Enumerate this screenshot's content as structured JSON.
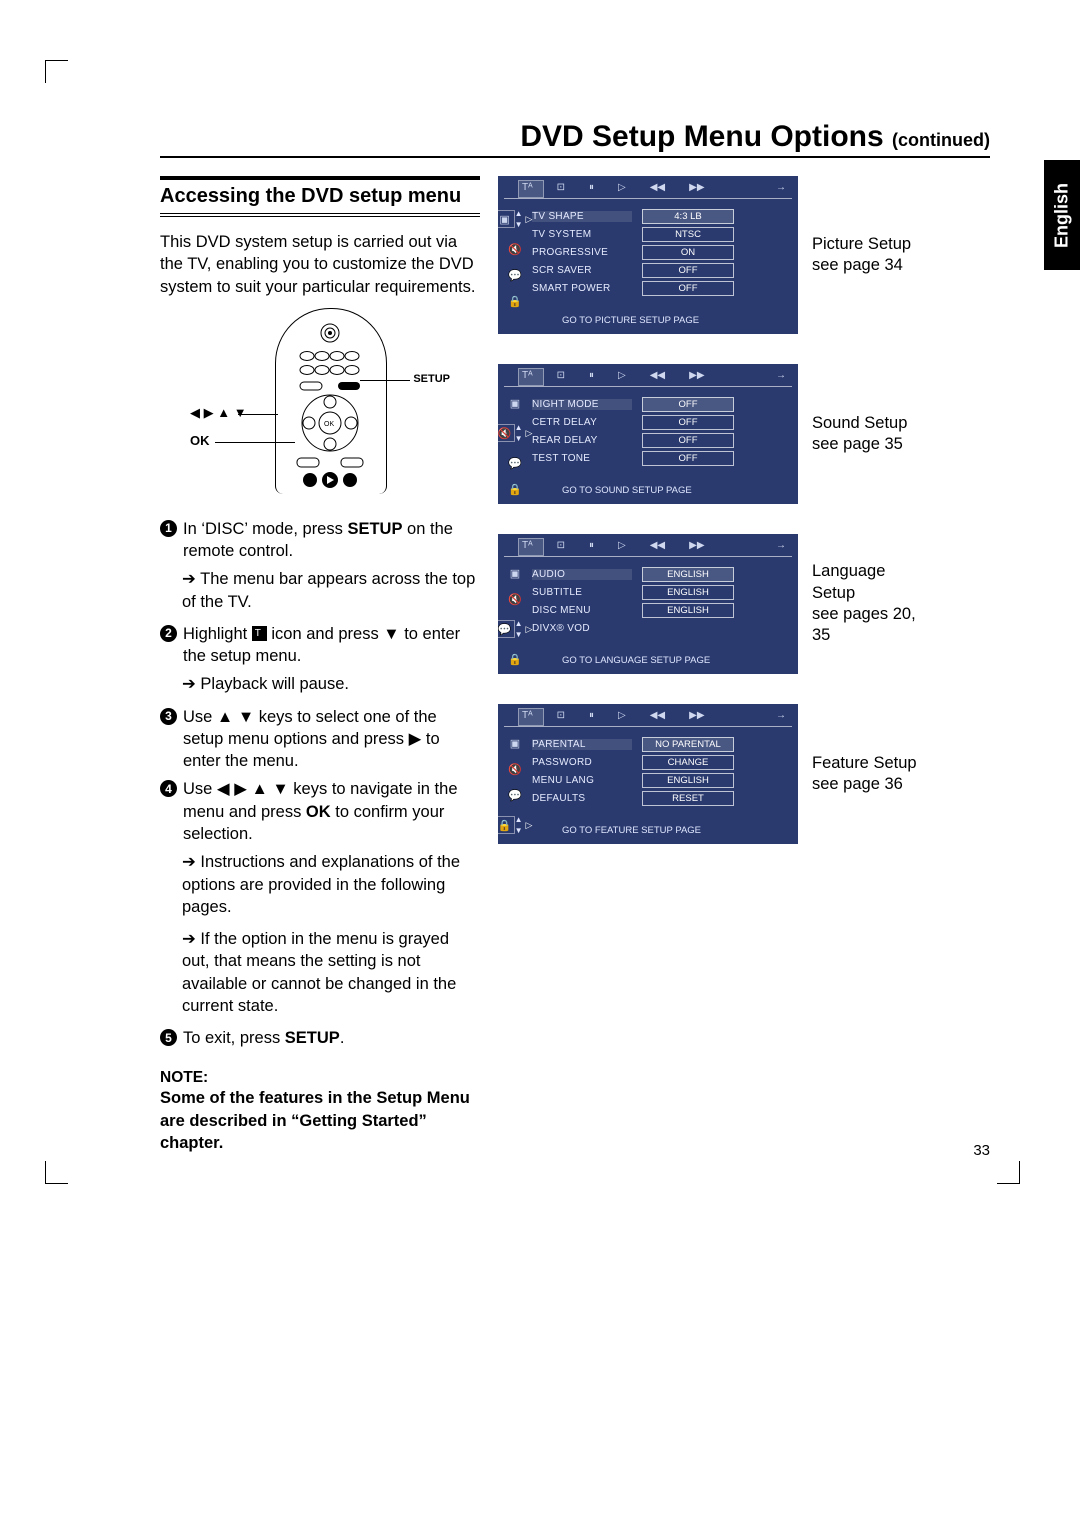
{
  "title": "DVD Setup Menu Options",
  "title_cont": "(continued)",
  "lang_tab": "English",
  "page_number": "33",
  "section_heading": "Accessing the DVD setup menu",
  "intro": "This DVD system setup is carried out via the TV, enabling you to customize the DVD system to suit your particular requirements.",
  "remote": {
    "setup": "SETUP",
    "arrows": "◀ ▶ ▲ ▼",
    "ok": "OK"
  },
  "steps": {
    "s1": "In ‘DISC’ mode, press SETUP on the remote control.",
    "s1a": "The menu bar appears across the top of the TV.",
    "s2a": "Highlight ",
    "s2b": " icon and press ▼ to enter the setup menu.",
    "s2c": "Playback will pause.",
    "s3": "Use ▲ ▼ keys to select one of the setup menu options and press ▶ to enter the menu.",
    "s4": "Use ◀ ▶ ▲ ▼ keys to navigate in the menu and press OK to confirm your selection.",
    "s4a": "Instructions and explanations of the options are provided in the following pages.",
    "s4b": "If the option in the menu is grayed out, that means the setting is not available or cannot be changed in the current state.",
    "s5": "To exit, press SETUP."
  },
  "note_h": "NOTE:",
  "note_b": "Some of the features in the Setup Menu are described in “Getting Started” chapter.",
  "osd": {
    "picture": {
      "caption": "Picture Setup see page 34",
      "rows": [
        {
          "lbl": "TV SHAPE",
          "val": "4:3 LB"
        },
        {
          "lbl": "TV SYSTEM",
          "val": "NTSC"
        },
        {
          "lbl": "PROGRESSIVE",
          "val": "ON"
        },
        {
          "lbl": "SCR SAVER",
          "val": "OFF"
        },
        {
          "lbl": "SMART POWER",
          "val": "OFF"
        }
      ],
      "foot": "GO TO  PICTURE SETUP PAGE",
      "sel": 0
    },
    "sound": {
      "caption": "Sound Setup see page 35",
      "rows": [
        {
          "lbl": "NIGHT MODE",
          "val": "OFF"
        },
        {
          "lbl": "CETR DELAY",
          "val": "OFF"
        },
        {
          "lbl": "REAR DELAY",
          "val": "OFF"
        },
        {
          "lbl": "TEST TONE",
          "val": "OFF"
        }
      ],
      "foot": "GO TO  SOUND SETUP PAGE",
      "sel": 1
    },
    "language": {
      "caption": "Language Setup see pages 20, 35",
      "rows": [
        {
          "lbl": "AUDIO",
          "val": "ENGLISH"
        },
        {
          "lbl": "SUBTITLE",
          "val": "ENGLISH"
        },
        {
          "lbl": "DISC MENU",
          "val": "ENGLISH"
        },
        {
          "lbl": "DIVX® VOD",
          "val": ""
        }
      ],
      "foot": "GO TO  LANGUAGE SETUP PAGE",
      "sel": 2
    },
    "feature": {
      "caption": "Feature Setup see page 36",
      "rows": [
        {
          "lbl": "PARENTAL",
          "val": "NO PARENTAL"
        },
        {
          "lbl": "PASSWORD",
          "val": "CHANGE"
        },
        {
          "lbl": "MENU LANG",
          "val": "ENGLISH"
        },
        {
          "lbl": "DEFAULTS",
          "val": "RESET"
        }
      ],
      "foot": "GO TO FEATURE SETUP PAGE",
      "sel": 3
    }
  }
}
